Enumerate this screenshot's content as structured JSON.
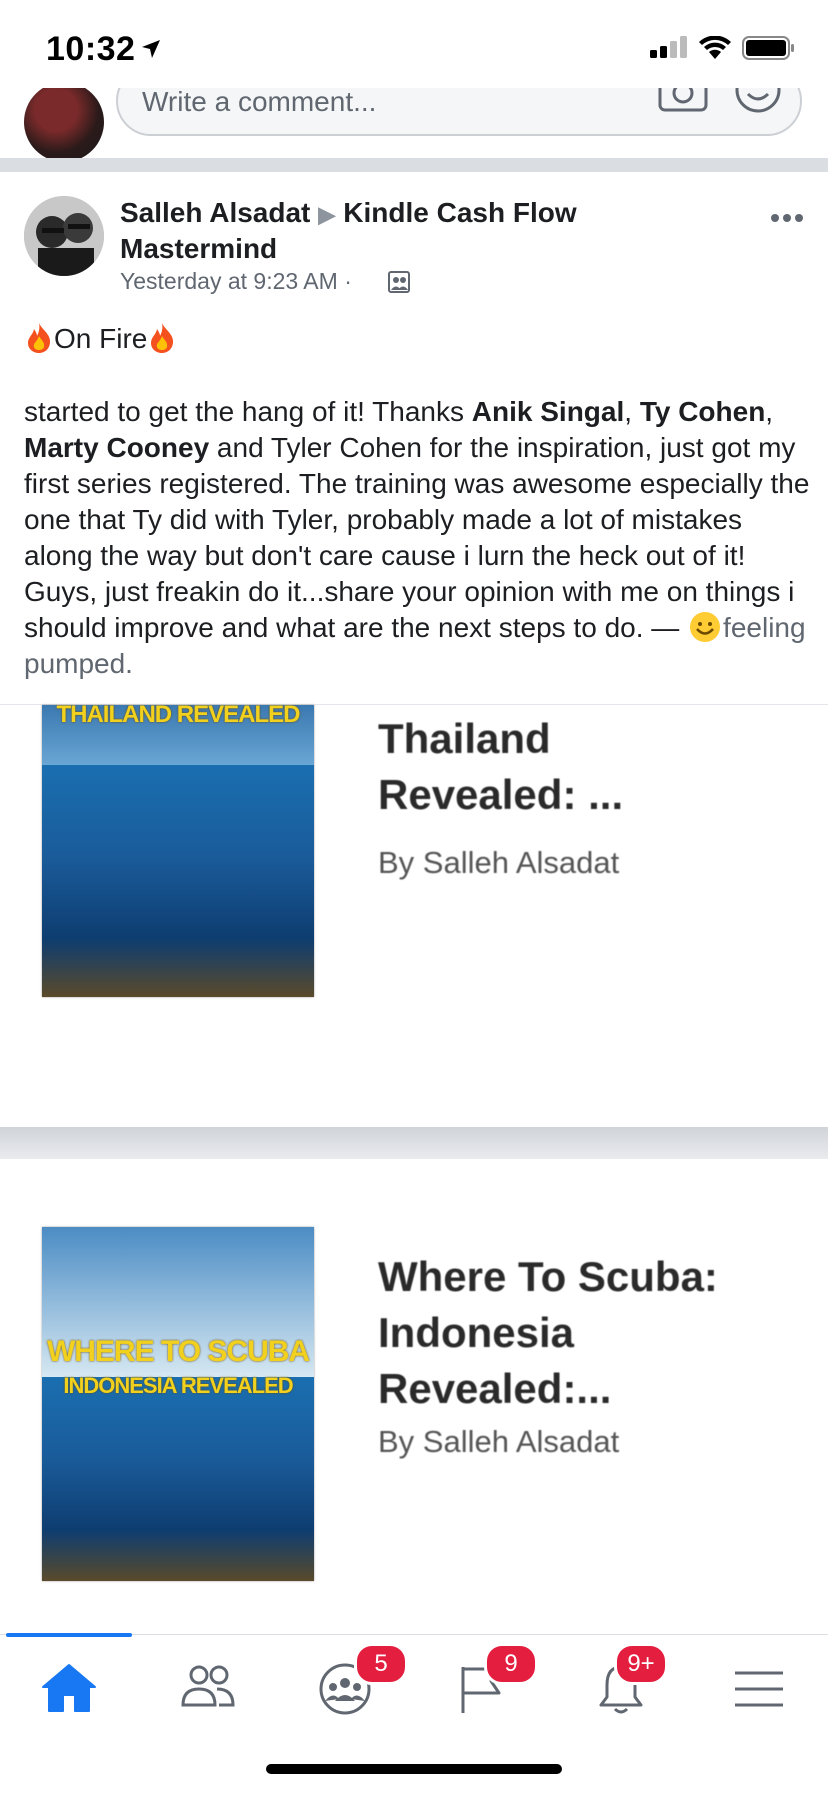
{
  "status_bar": {
    "time": "10:32"
  },
  "comment_box": {
    "placeholder": "Write a comment..."
  },
  "post": {
    "author": "Salleh Alsadat",
    "group": "Kindle Cash Flow Mastermind",
    "timestamp": "Yesterday at 9:23 AM",
    "separator": "·",
    "status_label": "On Fire",
    "body": {
      "t1": "started to get the hang of it! Thanks ",
      "tag1": "Anik Singal",
      "t2": ", ",
      "tag2": "Ty Cohen",
      "t3": ", ",
      "tag3": "Marty Cooney",
      "t4": " and Tyler Cohen for the inspiration, just got my first series registered. The training was awesome especially the one that Ty did with Tyler, probably made a lot of mistakes along the way but don't care cause i lurn the heck out of it! Guys, just freakin do it...share your opinion with me on things i should improve and what are the next steps to do. — ",
      "feeling": "feeling pumped."
    }
  },
  "books": [
    {
      "title_line1": "Thailand",
      "title_line2": "Revealed: ...",
      "author": "By Salleh Alsadat",
      "cover_text": "THAILAND REVEALED"
    },
    {
      "title_line1": "Where To Scuba:",
      "title_line2": "Indonesia",
      "title_line3": "Revealed:...",
      "author": "By Salleh Alsadat",
      "cover_text_line1": "WHERE TO SCUBA",
      "cover_text_line2": "INDONESIA REVEALED"
    }
  ],
  "tab_bar": {
    "tabs": [
      {
        "name": "home-icon",
        "active": true
      },
      {
        "name": "friends-icon"
      },
      {
        "name": "groups-icon",
        "badge": "5"
      },
      {
        "name": "pages-icon",
        "badge": "9"
      },
      {
        "name": "notifications-icon",
        "badge": "9+"
      },
      {
        "name": "menu-icon"
      }
    ]
  },
  "colors": {
    "accent": "#1877f2",
    "badge": "#e41e3f",
    "divider": "#dadde1"
  }
}
